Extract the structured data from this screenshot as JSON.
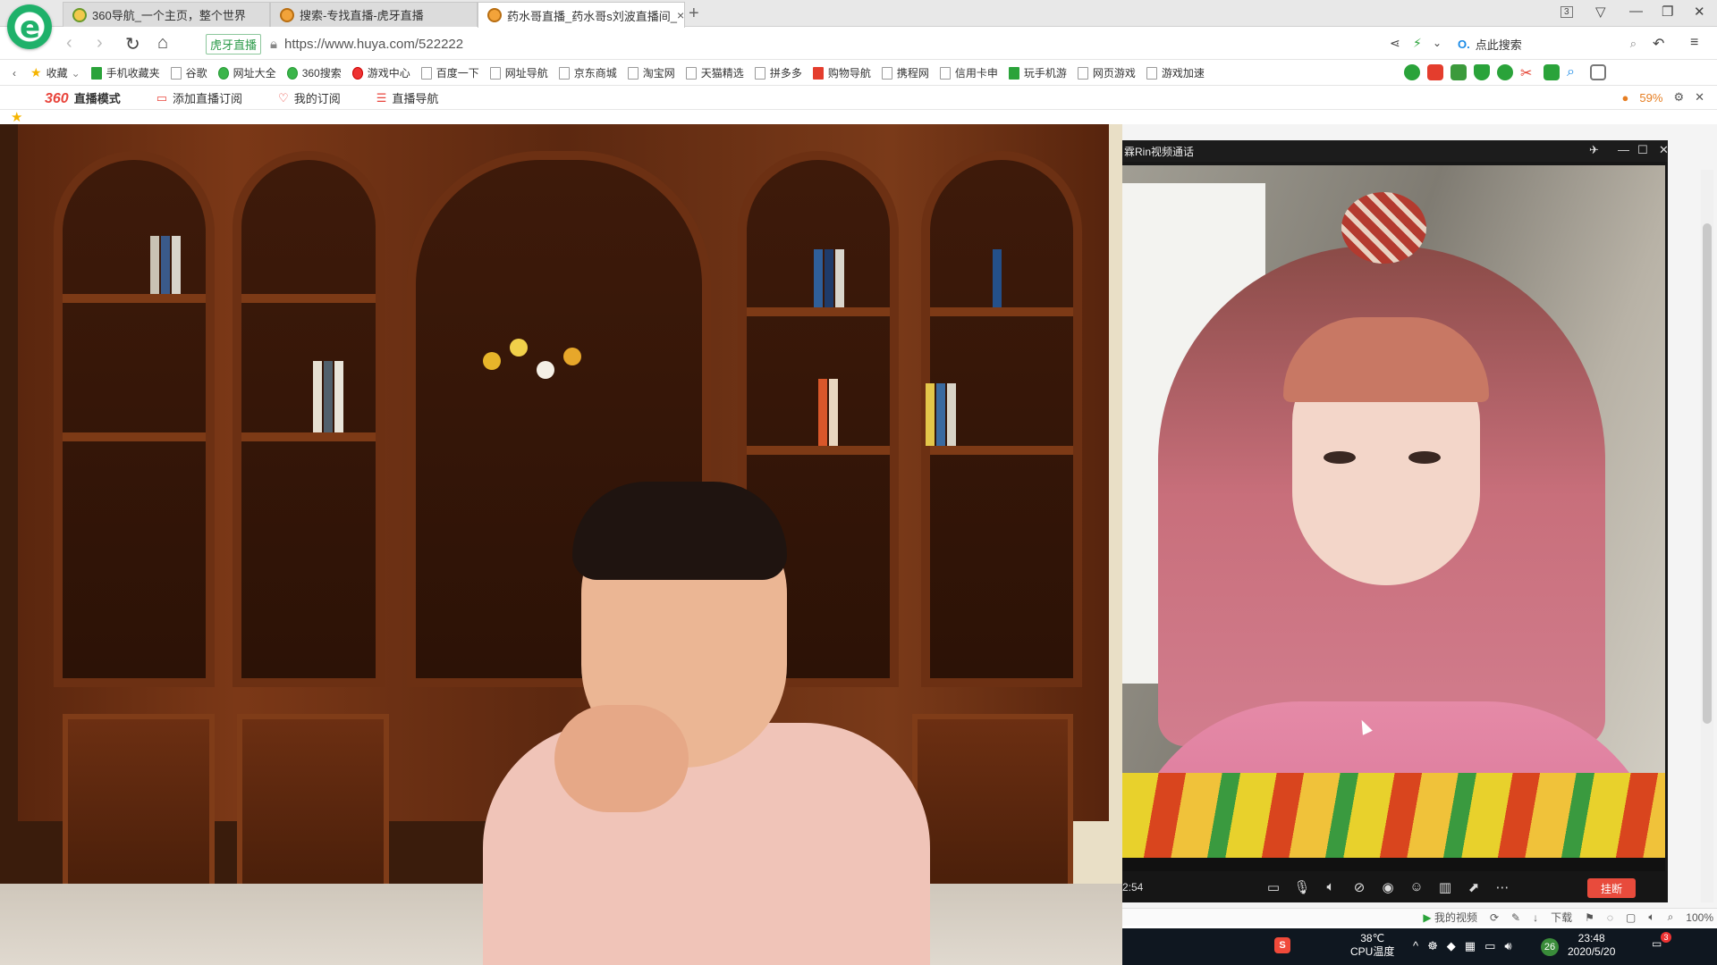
{
  "tabs": [
    {
      "title": "360导航_一个主页，整个世界",
      "active": false
    },
    {
      "title": "搜索-专找直播-虎牙直播",
      "active": false
    },
    {
      "title": "药水哥直播_药水哥s刘波直播间_",
      "active": true
    }
  ],
  "tab_counter": "3",
  "address": {
    "site_badge": "虎牙直播",
    "url": "https://www.huya.com/522222"
  },
  "search": {
    "placeholder": "点此搜索"
  },
  "bookmarks": [
    "收藏",
    "手机收藏夹",
    "谷歌",
    "网址大全",
    "360搜索",
    "游戏中心",
    "百度一下",
    "网址导航",
    "京东商城",
    "淘宝网",
    "天猫精选",
    "拼多多",
    "购物导航",
    "携程网",
    "信用卡申",
    "玩手机游",
    "网页游戏",
    "游戏加速"
  ],
  "livebar": {
    "brand_logo": "360",
    "brand_text": "直播模式",
    "items": [
      "添加直播订阅",
      "我的订阅",
      "直播导航"
    ],
    "battery": "59%"
  },
  "call": {
    "title": "霖Rin视频通话",
    "timer": "2:54",
    "hangup_label": "挂断"
  },
  "statusbar": {
    "video": "我的视频",
    "download": "下载",
    "zoom": "100%"
  },
  "taskbar": {
    "temp": "38℃",
    "temp_label": "CPU温度",
    "badge": "26",
    "time": "23:48",
    "date": "2020/5/20",
    "notif_count": "3"
  },
  "colors": {
    "accent_red": "#e84b3c",
    "brand_green": "#1fb16a",
    "huya_orange": "#f2a33a"
  }
}
